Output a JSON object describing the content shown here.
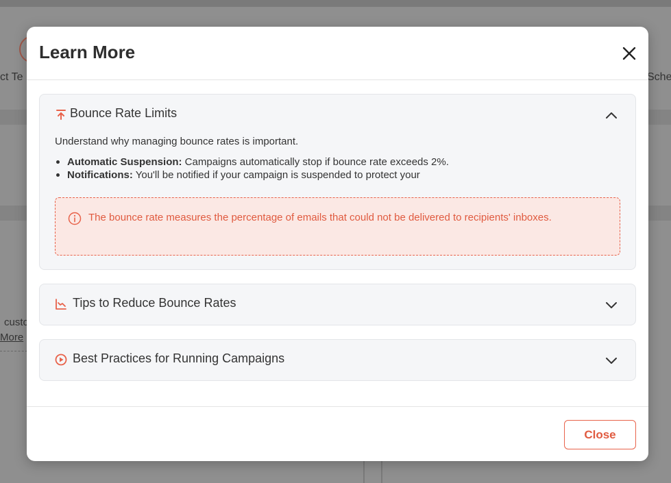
{
  "background": {
    "step_left_label": "ct Te",
    "step_right_label": "Sche",
    "snippet_text": "custo",
    "snippet_link": "More"
  },
  "modal": {
    "title": "Learn More",
    "close_icon": "close-icon",
    "sections": [
      {
        "icon": "arrow-up-to-line-icon",
        "title": "Bounce Rate Limits",
        "expanded": true,
        "intro": "Understand why managing bounce rates is important.",
        "bullets": [
          {
            "bold": "Automatic Suspension:",
            "text": " Campaigns automatically stop if bounce rate exceeds 2%."
          },
          {
            "bold": "Notifications:",
            "text": " You'll be notified if your campaign is suspended to protect your"
          }
        ],
        "alert": "The bounce rate measures the percentage of emails that could not be delivered to recipients' inboxes."
      },
      {
        "icon": "chart-line-down-icon",
        "title": "Tips to Reduce Bounce Rates",
        "expanded": false
      },
      {
        "icon": "play-circle-icon",
        "title": "Best Practices for Running Campaigns",
        "expanded": false
      }
    ],
    "footer": {
      "close_label": "Close"
    }
  },
  "colors": {
    "accent": "#e8624a",
    "alert_bg": "#fbe8e4",
    "panel_bg": "#f5f6f8"
  }
}
